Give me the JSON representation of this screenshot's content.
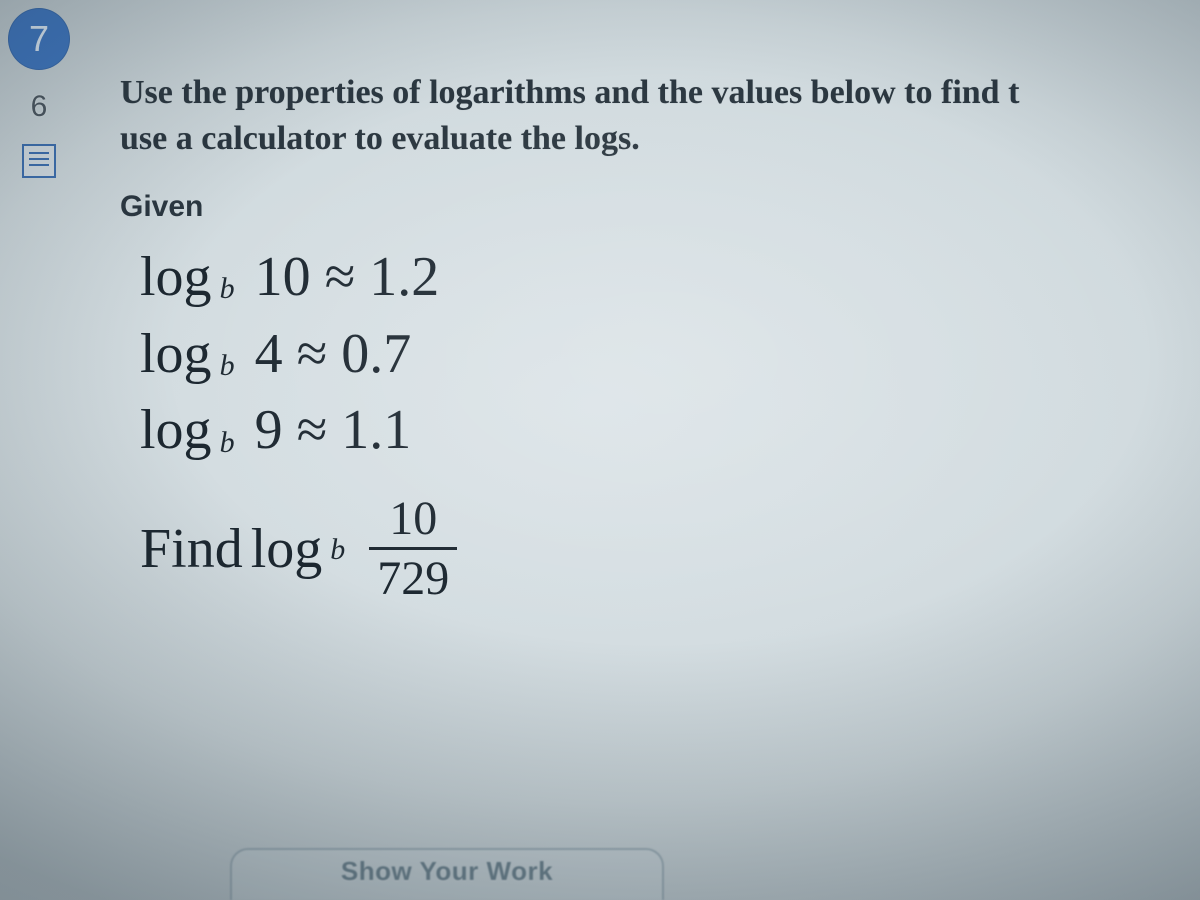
{
  "gutter": {
    "question_number": "7",
    "points": "6"
  },
  "prompt": {
    "line1": "Use the properties of logarithms and the values below to find t",
    "line2": "use a calculator to evaluate the logs."
  },
  "given_label": "Given",
  "given": [
    {
      "func": "log",
      "base": "b",
      "expr": "10 ≈ 1.2"
    },
    {
      "func": "log",
      "base": "b",
      "expr": "4 ≈ 0.7"
    },
    {
      "func": "log",
      "base": "b",
      "expr": "9 ≈ 1.1"
    }
  ],
  "find": {
    "prefix": "Find",
    "func": "log",
    "base": "b",
    "numerator": "10",
    "denominator": "729"
  },
  "work_tab": "Show Your Work"
}
